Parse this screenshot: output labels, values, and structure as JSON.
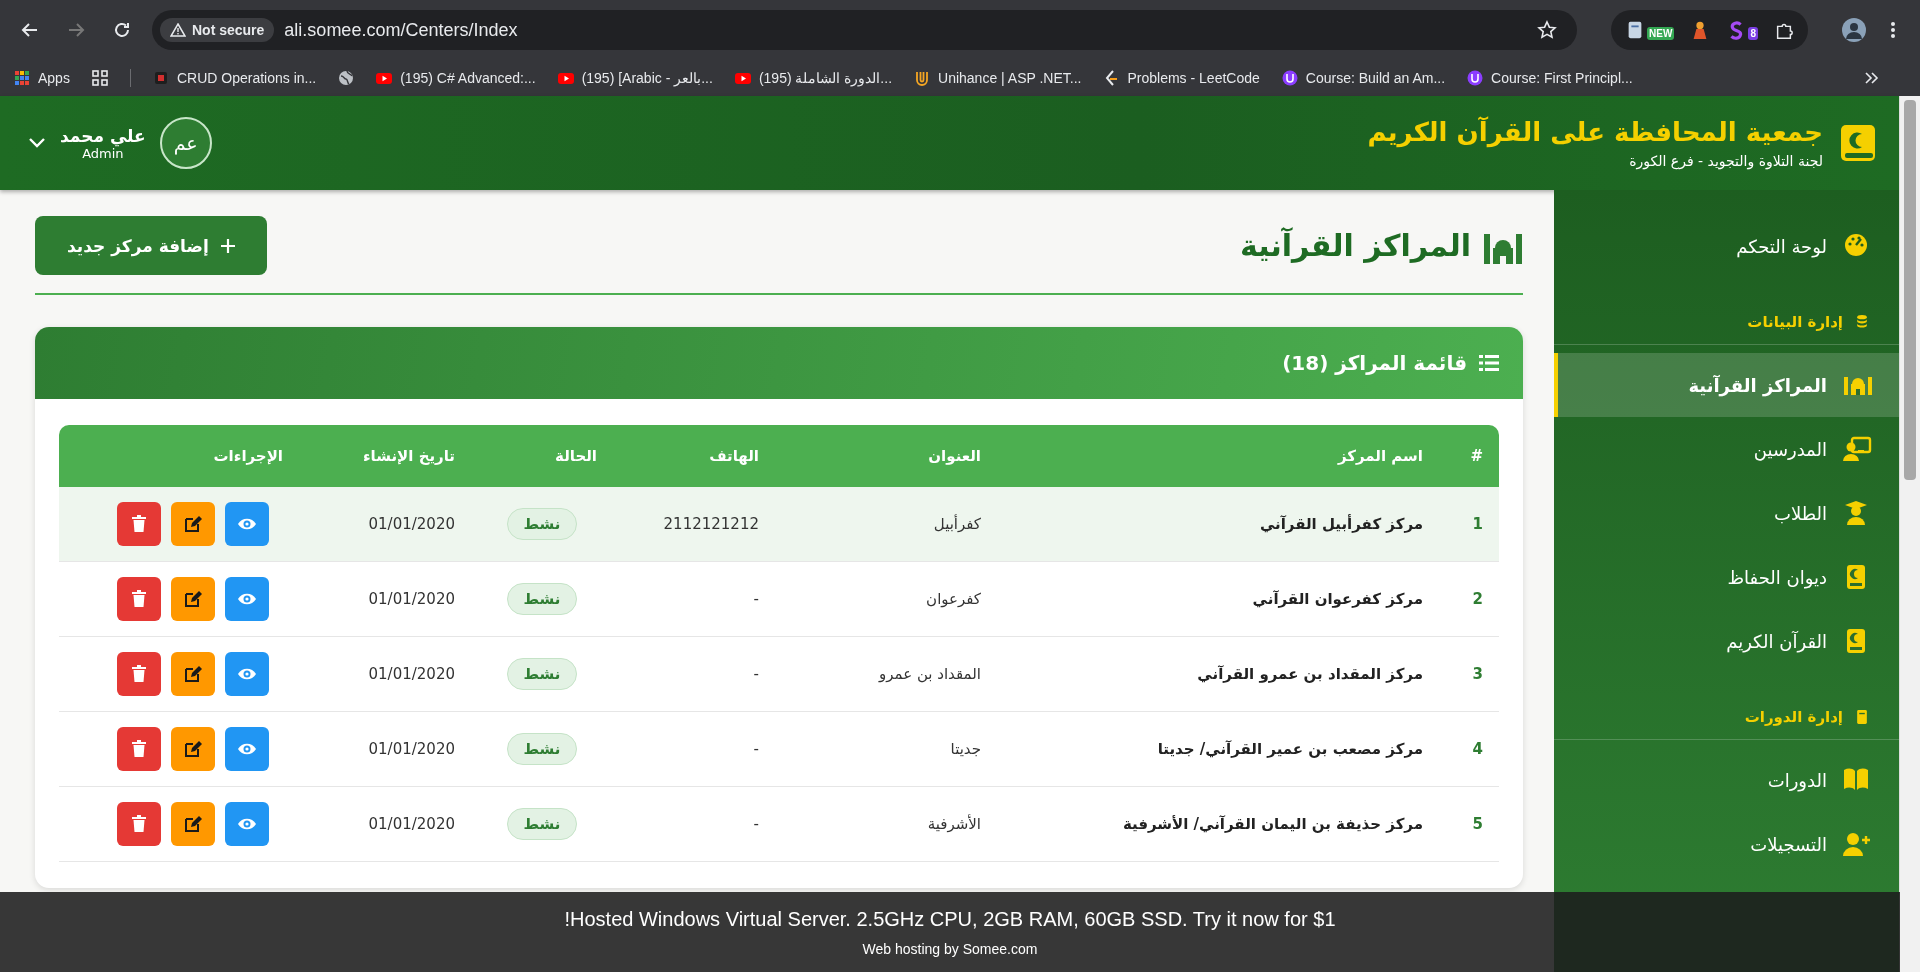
{
  "browser": {
    "security_label": "Not secure",
    "url": "ali.somee.com/Centers/Index",
    "extensions": {
      "document_extension": {
        "kind": "doc",
        "badge": "NEW"
      },
      "figure_extension": {
        "kind": "figure"
      },
      "swirl_extension": {
        "kind": "s",
        "badge": "8"
      },
      "extensions_menu": {
        "kind": "puzzle"
      }
    },
    "bookmarks": {
      "apps": {
        "kind": "apps",
        "label": "Apps"
      },
      "grid": {
        "kind": "grid"
      },
      "separator": {
        "kind": "separator"
      },
      "crud": {
        "kind": "red",
        "label": "CRUD Operations in..."
      },
      "globe": {
        "kind": "globe"
      },
      "csharp": {
        "kind": "youtube",
        "label": "(195) C# Advanced:..."
      },
      "arabic_video": {
        "kind": "youtube",
        "label": "(195) [Arabic - بالعر..."
      },
      "arabic_course": {
        "kind": "youtube",
        "label": "(195) الدورة الشاملة..."
      },
      "unihance": {
        "kind": "unihance",
        "label": "Unihance | ASP .NET..."
      },
      "leetcode": {
        "kind": "leetcode",
        "label": "Problems - LeetCode"
      },
      "course_build": {
        "kind": "course",
        "label": "Course: Build an Am..."
      },
      "course_first": {
        "kind": "course",
        "label": "Course: First Principl..."
      }
    }
  },
  "header": {
    "title": "جمعية المحافظة على القرآن الكريم",
    "subtitle": "لجنة التلاوة والتجويد - فرع الكورة",
    "user": {
      "initials": "عم",
      "name": "علي محمد",
      "role": "Admin"
    }
  },
  "sidebar": {
    "items": [
      {
        "kind": "link",
        "label": "لوحة التحكم",
        "selected": false
      },
      {
        "kind": "section",
        "label": "إدارة البيانات"
      },
      {
        "kind": "link",
        "label": "المراكز القرآنية",
        "selected": true
      },
      {
        "kind": "link",
        "label": "المدرسين",
        "selected": false
      },
      {
        "kind": "link",
        "label": "الطلاب",
        "selected": false
      },
      {
        "kind": "link",
        "label": "ديوان الحفاظ",
        "selected": false
      },
      {
        "kind": "link",
        "label": "القرآن الكريم",
        "selected": false
      },
      {
        "kind": "section",
        "label": "إدارة الدورات"
      },
      {
        "kind": "link",
        "label": "الدورات",
        "selected": false
      },
      {
        "kind": "link",
        "label": "التسجيلات",
        "selected": false
      }
    ]
  },
  "page": {
    "title": "المراكز القرآنية",
    "add_button": "إضافة مركز جديد"
  },
  "card": {
    "title": "قائمة المراكز (18)"
  },
  "table": {
    "columns": [
      "#",
      "اسم المركز",
      "العنوان",
      "الهاتف",
      "الحالة",
      "تاريخ الإنشاء",
      "الإجراءات"
    ],
    "rows": [
      {
        "number": "1",
        "name": "مركز كفرأبيل القرآني",
        "address": "كفرأبيل",
        "phone": "2112121212",
        "status": "نشط",
        "created": "01/01/2020",
        "selected": true
      },
      {
        "number": "2",
        "name": "مركز كفرعوان القرآني",
        "address": "كفرعوان",
        "phone": "-",
        "status": "نشط",
        "created": "01/01/2020",
        "selected": false
      },
      {
        "number": "3",
        "name": "مركز المقداد بن عمرو القرآني",
        "address": "المقداد بن عمرو",
        "phone": "-",
        "status": "نشط",
        "created": "01/01/2020",
        "selected": false
      },
      {
        "number": "4",
        "name": "مركز مصعب بن عمير القرآني/ جديتا",
        "address": "جديتا",
        "phone": "-",
        "status": "نشط",
        "created": "01/01/2020",
        "selected": false
      },
      {
        "number": "5",
        "name": "مركز حذيفة بن اليمان القرآني/ الأشرفية",
        "address": "الأشرفية",
        "phone": "-",
        "status": "نشط",
        "created": "01/01/2020",
        "selected": false
      }
    ]
  },
  "ad_bar": {
    "text": "!Hosted Windows Virtual Server. 2.5GHz CPU, 2GB RAM, 60GB SSD. Try it now for $1",
    "footer": "Web hosting by Somee.com"
  }
}
